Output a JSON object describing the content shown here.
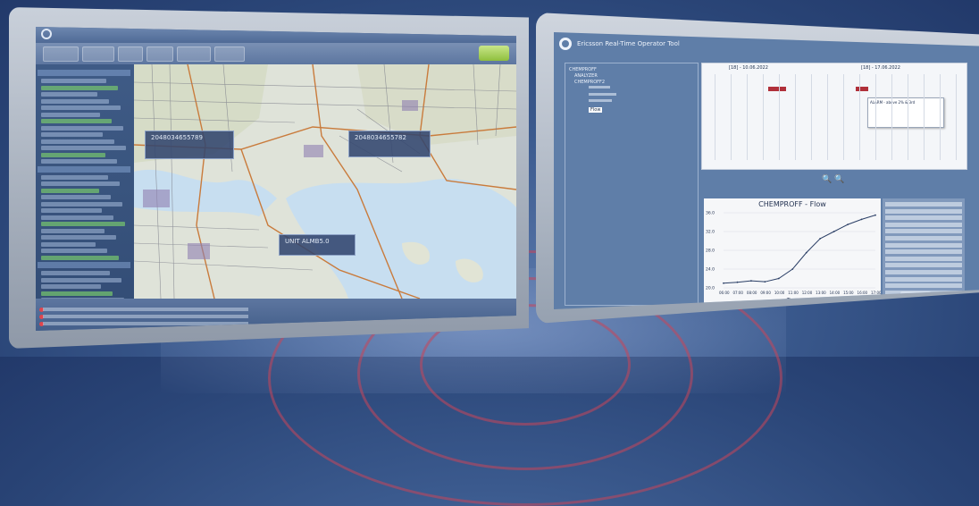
{
  "left_screen": {
    "map_labels": [
      {
        "id": "label-1",
        "text": "2048034655789"
      },
      {
        "id": "label-2",
        "text": "2048034655782"
      },
      {
        "id": "label-3",
        "text": "UNIT ALMB5.0"
      }
    ]
  },
  "right_screen": {
    "app_title": "Ericsson Real-Time Operator Tool",
    "tree_items": [
      "CHEMPROFF",
      "ANALYZER",
      "CHEMPROFF2",
      "Flow"
    ],
    "timeline_dates": [
      "[18] - 10.06.2022",
      "[18] - 17.06.2022"
    ],
    "popup_title": "ALARM - above 2% & 3rd",
    "zoom_icons": "🔍 🔍",
    "chart": {
      "title": "CHEMPROFF - Flow",
      "xlabel": "Time"
    }
  },
  "colors": {
    "alarm": "#b0303a",
    "accent_green": "#8fbf3e",
    "background": "#2a4577"
  },
  "chart_data": {
    "type": "line",
    "title": "CHEMPROFF - Flow",
    "xlabel": "Time",
    "ylabel": "",
    "x": [
      "06:00",
      "07:00",
      "08:00",
      "09:00",
      "10:00",
      "11:00",
      "12:00",
      "13:00",
      "14:00",
      "15:00",
      "16:00",
      "17:00"
    ],
    "series": [
      {
        "name": "Flow",
        "values": [
          21.0,
          21.2,
          21.5,
          21.3,
          22.0,
          24.0,
          27.5,
          30.5,
          32.0,
          33.5,
          34.6,
          35.5
        ]
      }
    ],
    "ylim": [
      20,
      36
    ],
    "grid": true,
    "legend": "none"
  }
}
